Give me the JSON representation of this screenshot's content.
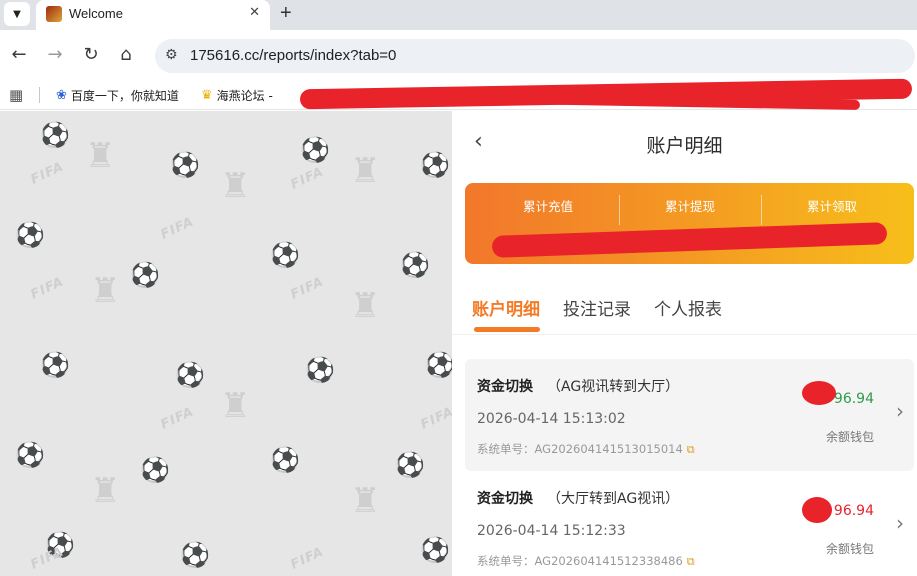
{
  "browser": {
    "tab_title": "Welcome",
    "close_glyph": "✕",
    "new_tab_glyph": "+",
    "url": "175616.cc/reports/index?tab=0",
    "nav": {
      "back": "←",
      "forward": "→",
      "reload": "↻",
      "home": "⌂"
    },
    "bookmarks": [
      {
        "label": "百度一下，你就知道",
        "icon": "baidu-paw-icon"
      },
      {
        "label": "海燕论坛 -",
        "icon": "trophy-icon"
      }
    ]
  },
  "app": {
    "back_glyph": "‹",
    "title": "账户明细",
    "summary": {
      "items": [
        {
          "label": "累计充值"
        },
        {
          "label": "累计提现"
        },
        {
          "label": "累计领取"
        }
      ],
      "accent": "#f47a25"
    },
    "tabs": [
      {
        "label": "账户明细",
        "active": true
      },
      {
        "label": "投注记录",
        "active": false
      },
      {
        "label": "个人报表",
        "active": false
      }
    ],
    "records": [
      {
        "type": "资金切换",
        "desc": "（AG视讯转到大厅）",
        "time": "2026-04-14 15:13:02",
        "order_prefix": "系统单号：",
        "order_no": "AG202604141513015014",
        "amount": "96.94",
        "wallet": "余额钱包"
      },
      {
        "type": "资金切换",
        "desc": "（大厅转到AG视讯）",
        "time": "2026-04-14 15:12:33",
        "order_prefix": "系统单号：",
        "order_no": "AG202604141512338486",
        "amount": "96.94",
        "wallet": "余额钱包"
      }
    ]
  },
  "background": {
    "watermark": "FIFA"
  },
  "colors": {
    "accent": "#f47a25",
    "positive": "#2e9b4a",
    "negative": "#e8232a"
  }
}
